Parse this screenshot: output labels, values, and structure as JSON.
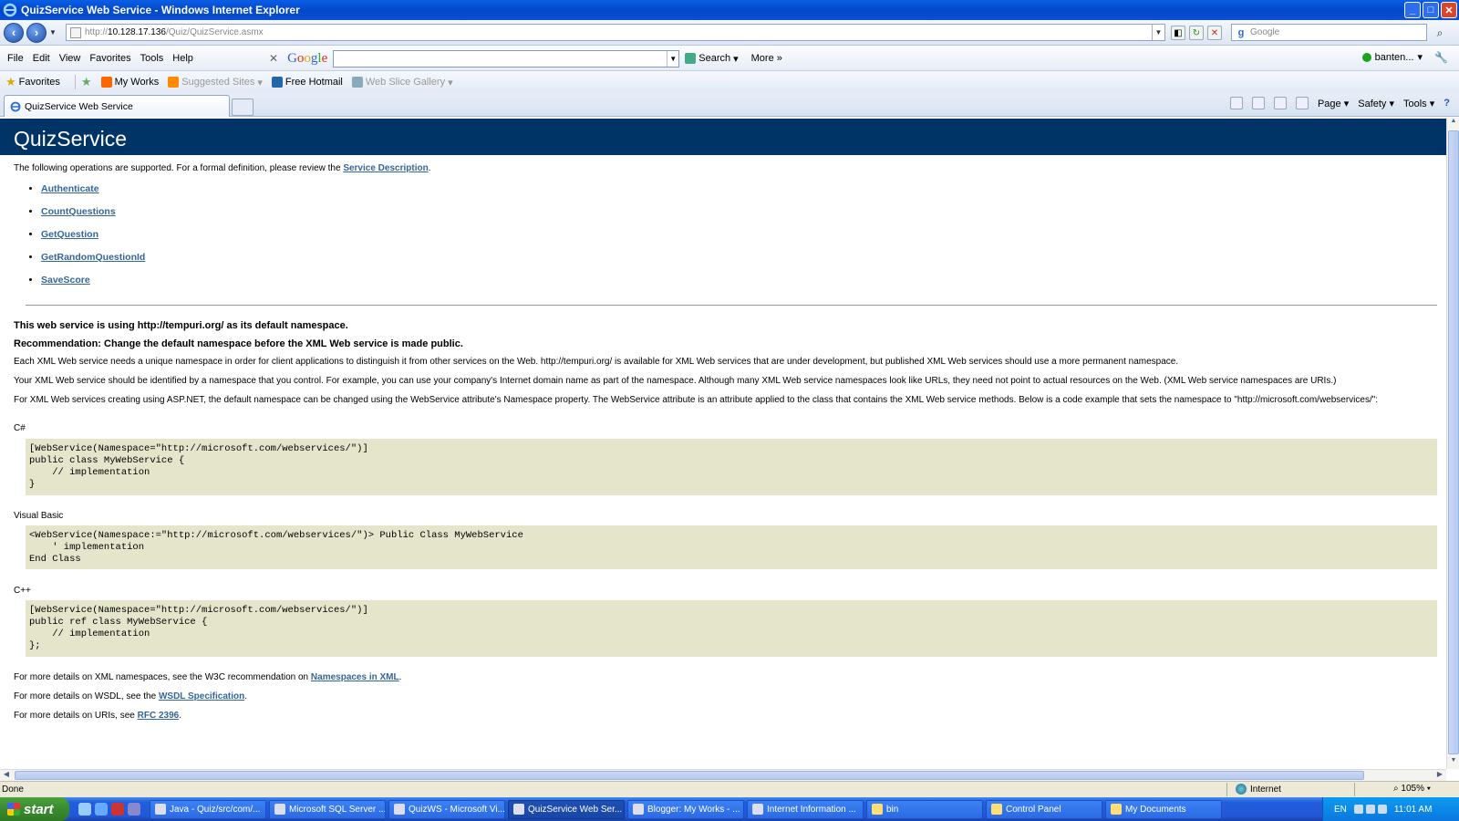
{
  "window": {
    "title": "QuizService Web Service - Windows Internet Explorer"
  },
  "address": {
    "url_prefix": "http://",
    "url_host": "10.128.17.136",
    "url_path": "/Quiz/QuizService.asmx"
  },
  "search_box": {
    "placeholder": "Google"
  },
  "menu": [
    "File",
    "Edit",
    "View",
    "Favorites",
    "Tools",
    "Help"
  ],
  "google_toolbar": {
    "search_label": "Search",
    "more_label": "More »",
    "user": "banten..."
  },
  "favorites_bar": {
    "favorites": "Favorites",
    "items": [
      "My Works",
      "Suggested Sites",
      "Free Hotmail",
      "Web Slice Gallery"
    ]
  },
  "tab": {
    "title": "QuizService Web Service"
  },
  "command_bar": {
    "page": "Page",
    "safety": "Safety",
    "tools": "Tools"
  },
  "page": {
    "heading": "QuizService",
    "intro_text": "The following operations are supported. For a formal definition, please review the ",
    "service_description": "Service Description",
    "operations": [
      "Authenticate",
      "CountQuestions",
      "GetQuestion",
      "GetRandomQuestionId",
      "SaveScore"
    ],
    "namespace_line": "This web service is using http://tempuri.org/ as its default namespace.",
    "recommendation": "Recommendation: Change the default namespace before the XML Web service is made public.",
    "para1": "Each XML Web service needs a unique namespace in order for client applications to distinguish it from other services on the Web. http://tempuri.org/ is available for XML Web services that are under development, but published XML Web services should use a more permanent namespace.",
    "para2": "Your XML Web service should be identified by a namespace that you control. For example, you can use your company's Internet domain name as part of the namespace. Although many XML Web service namespaces look like URLs, they need not point to actual resources on the Web. (XML Web service namespaces are URIs.)",
    "para3": "For XML Web services creating using ASP.NET, the default namespace can be changed using the WebService attribute's Namespace property. The WebService attribute is an attribute applied to the class that contains the XML Web service methods. Below is a code example that sets the namespace to \"http://microsoft.com/webservices/\":",
    "csharp_label": "C#",
    "csharp_code": "[WebService(Namespace=\"http://microsoft.com/webservices/\")]\npublic class MyWebService {\n    // implementation\n}",
    "vb_label": "Visual Basic",
    "vb_code": "<WebService(Namespace:=\"http://microsoft.com/webservices/\")> Public Class MyWebService\n    ' implementation\nEnd Class",
    "cpp_label": "C++",
    "cpp_code": "[WebService(Namespace=\"http://microsoft.com/webservices/\")]\npublic ref class MyWebService {\n    // implementation\n};",
    "more1_text": "For more details on XML namespaces, see the W3C recommendation on ",
    "more1_link": "Namespaces in XML",
    "more2_text": "For more details on WSDL, see the ",
    "more2_link": "WSDL Specification",
    "more3_text": "For more details on URIs, see ",
    "more3_link": "RFC 2396"
  },
  "status": {
    "text": "Done",
    "zone": "Internet",
    "zoom": "105%"
  },
  "taskbar": {
    "start": "start",
    "tasks": [
      "Java - Quiz/src/com/...",
      "Microsoft SQL Server ...",
      "QuizWS - Microsoft Vi...",
      "QuizService Web Ser...",
      "Blogger: My Works - ...",
      "Internet Information ...",
      "bin",
      "Control Panel",
      "My Documents"
    ],
    "lang": "EN",
    "clock": "11:01 AM"
  }
}
